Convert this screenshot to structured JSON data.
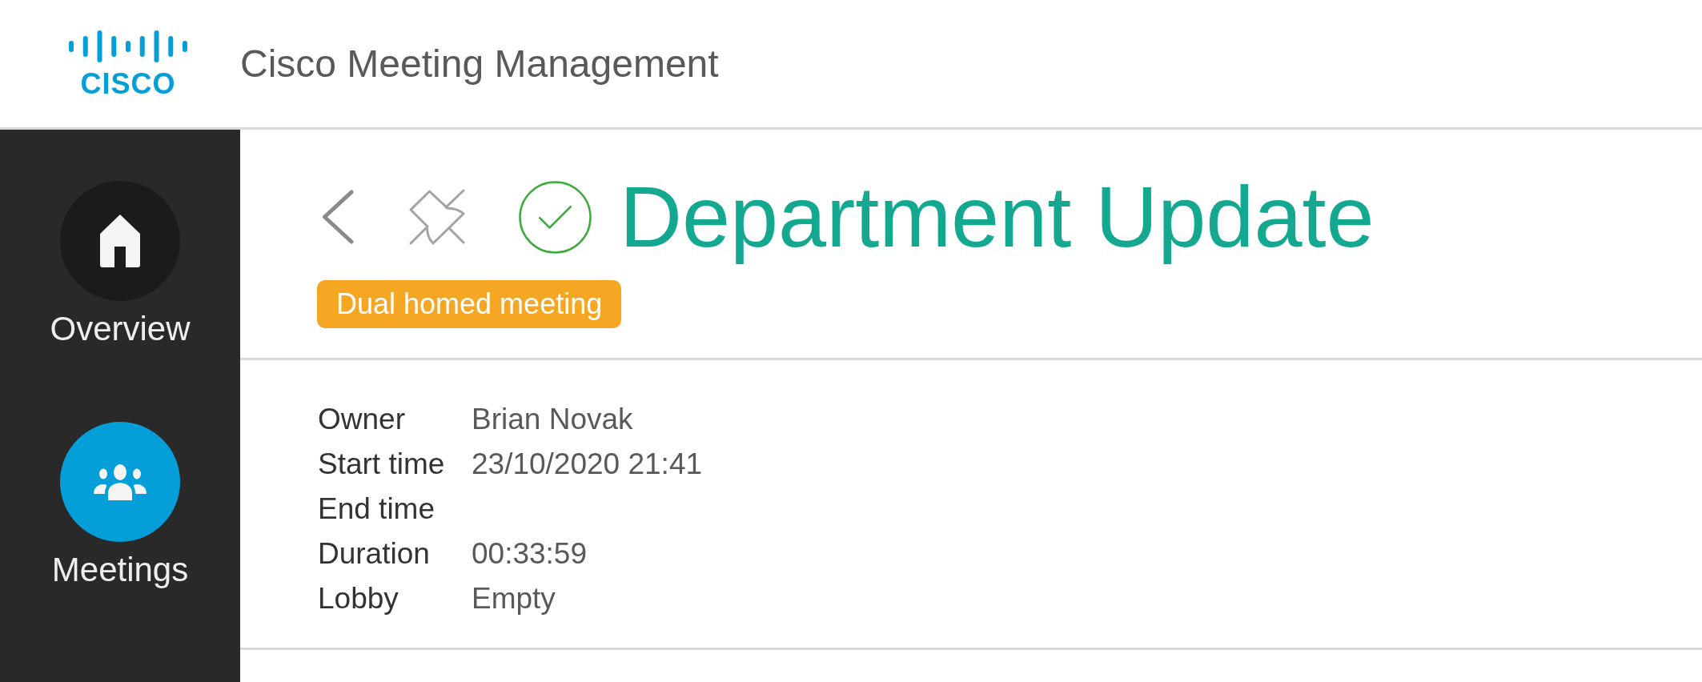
{
  "header": {
    "logo_text": "CISCO",
    "title": "Cisco Meeting Management"
  },
  "sidebar": {
    "items": [
      {
        "label": "Overview",
        "selected": false
      },
      {
        "label": "Meetings",
        "selected": true
      }
    ]
  },
  "meeting": {
    "title": "Department Update",
    "tags": [
      "Dual homed meeting"
    ],
    "details": [
      {
        "label": "Owner",
        "value": "Brian Novak"
      },
      {
        "label": "Start time",
        "value": "23/10/2020 21:41"
      },
      {
        "label": "End time"
      },
      {
        "label": "Duration",
        "value": "00:33:59"
      },
      {
        "label": "Lobby",
        "value": "Empty"
      }
    ]
  }
}
